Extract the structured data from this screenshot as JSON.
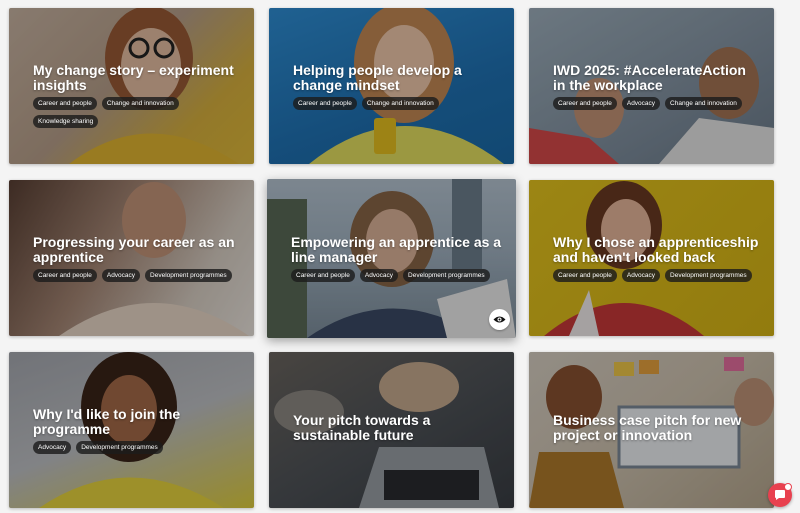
{
  "cards": [
    {
      "title": "My change story – experiment insights",
      "tags": [
        "Career and people",
        "Change and innovation",
        "Knowledge sharing"
      ],
      "accent": "#d9a441"
    },
    {
      "title": "Helping people develop a change mindset",
      "tags": [
        "Career and people",
        "Change and innovation"
      ],
      "accent": "#2b7fc4"
    },
    {
      "title": "IWD 2025: #AccelerateAction in the workplace",
      "tags": [
        "Career and people",
        "Advocacy",
        "Change and innovation"
      ],
      "accent": "#7a8a9a"
    },
    {
      "title": "Progressing your career as an apprentice",
      "tags": [
        "Career and people",
        "Advocacy",
        "Development programmes"
      ],
      "accent": "#8a6a55"
    },
    {
      "title": "Empowering an apprentice as a line manager",
      "tags": [
        "Career and people",
        "Advocacy",
        "Development programmes"
      ],
      "accent": "#7d93a3"
    },
    {
      "title": "Why I chose an apprenticeship and haven't looked back",
      "tags": [
        "Career and people",
        "Advocacy",
        "Development programmes"
      ],
      "accent": "#e2c21c"
    },
    {
      "title": "Why I'd like to join the programme",
      "tags": [
        "Advocacy",
        "Development programmes"
      ],
      "accent": "#e9d24a"
    },
    {
      "title": "Your pitch towards a sustainable future",
      "tags": [],
      "accent": "#5f6a74"
    },
    {
      "title": "Business case pitch for new project or innovation",
      "tags": [],
      "accent": "#c9b38a"
    }
  ],
  "icons": {
    "preview": "eye-icon",
    "chat": "chat-icon"
  },
  "colors": {
    "chat_button": "#e8414f",
    "tag_bg": "#1c1c1c"
  }
}
